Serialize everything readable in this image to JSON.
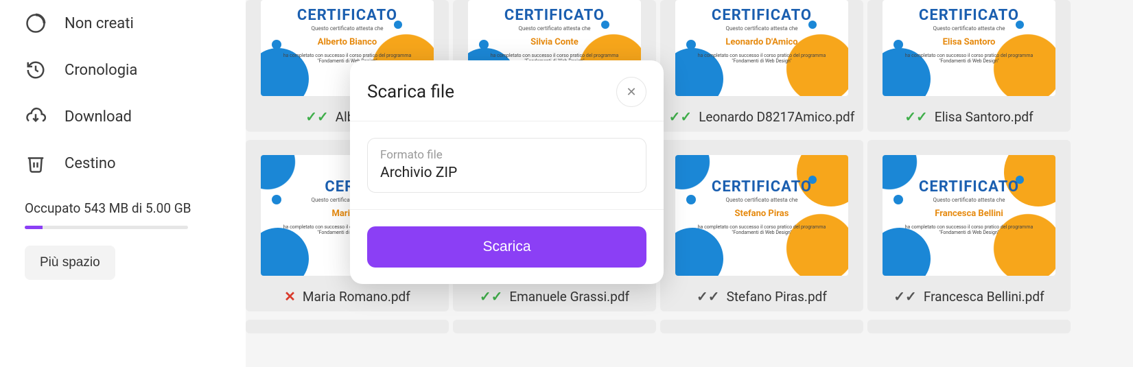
{
  "sidebar": {
    "items": [
      {
        "label": "Non creati"
      },
      {
        "label": "Cronologia"
      },
      {
        "label": "Download"
      },
      {
        "label": "Cestino"
      }
    ],
    "storage_text": "Occupato 543 MB di 5.00 GB",
    "more_space": "Più spazio"
  },
  "modal": {
    "title": "Scarica file",
    "format_label": "Formato file",
    "format_value": "Archivio ZIP",
    "download_button": "Scarica"
  },
  "cert": {
    "heading": "CERTIFICATO",
    "subtext": "Questo certificato attesta che",
    "desc1": "ha completato con successo il corso pratico del programma",
    "desc2": "\"Fondamenti di Web Design\""
  },
  "files": {
    "row1": [
      {
        "person": "Alberto Bianco",
        "filename": "Alberto B",
        "status": "green"
      },
      {
        "person": "Silvia Conte",
        "filename": "",
        "status": ""
      },
      {
        "person": "Leonardo D'Amico",
        "filename": "Leonardo D8217Amico.pdf",
        "status": "green"
      },
      {
        "person": "Elisa Santoro",
        "filename": "Elisa Santoro.pdf",
        "status": "green"
      }
    ],
    "row2": [
      {
        "person": "Maria R",
        "filename": "Maria Romano.pdf",
        "status": "red"
      },
      {
        "person": "",
        "filename": "Emanuele Grassi.pdf",
        "status": "green"
      },
      {
        "person": "Stefano Piras",
        "filename": "Stefano Piras.pdf",
        "status": "gray"
      },
      {
        "person": "Francesca Bellini",
        "filename": "Francesca Bellini.pdf",
        "status": "gray"
      }
    ]
  }
}
